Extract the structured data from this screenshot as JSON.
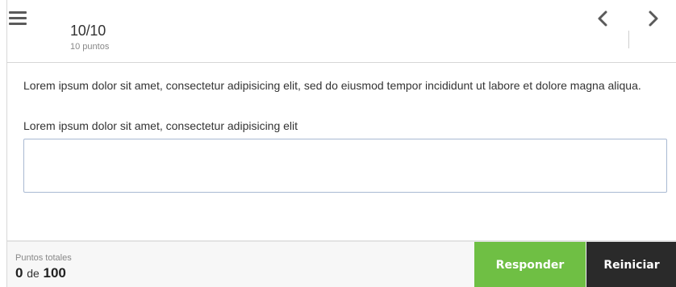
{
  "header": {
    "progress": "10/10",
    "points": "10 puntos"
  },
  "icons": {
    "menu": "hamburger-menu-icon",
    "prev": "chevron-left-icon",
    "next": "chevron-right-icon"
  },
  "content": {
    "paragraph": "Lorem ipsum dolor sit amet, consectetur adipisicing elit, sed do eiusmod tempor incididunt ut labore et dolore magna aliqua.",
    "question": "Lorem ipsum dolor sit amet, consectetur adipisicing elit",
    "answer_value": ""
  },
  "footer": {
    "score_label": "Puntos totales",
    "score": "0",
    "of": "de",
    "total": "100",
    "answer_button": "Responder",
    "reset_button": "Reiniciar"
  },
  "colors": {
    "answer_button": "#6fbf44",
    "reset_button": "#2a2a2a",
    "input_border": "#a9b9d2"
  }
}
